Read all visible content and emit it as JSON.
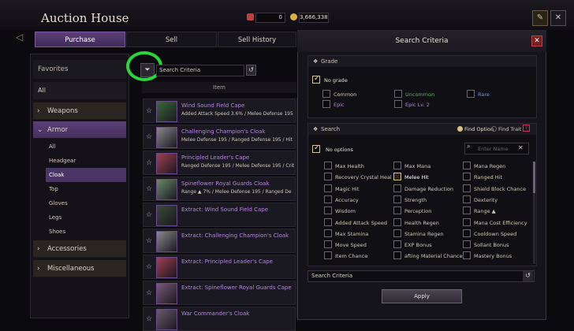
{
  "header": {
    "title": "Auction House",
    "currency1": "0",
    "currency2": "3,666,338"
  },
  "tabs": [
    {
      "label": "Purchase"
    },
    {
      "label": "Sell"
    },
    {
      "label": "Sell History"
    }
  ],
  "sidebar": {
    "favorites": "Favorites",
    "all": "All",
    "weapons": "Weapons",
    "armor": "Armor",
    "armor_subs": [
      "All",
      "Headgear",
      "Cloak",
      "Top",
      "Gloves",
      "Legs",
      "Shoes"
    ],
    "accessories": "Accessories",
    "misc": "Miscellaneous"
  },
  "list": {
    "search_placeholder": "Search Criteria",
    "column_item": "Item",
    "items": [
      {
        "name": "Wind Sound Field Cape",
        "stat": "Added Attack Speed 3.6% / Melee Defense 195"
      },
      {
        "name": "Challenging Champion's Cloak",
        "stat": "Melee Defense 195 / Ranged Defense 195 / Hit"
      },
      {
        "name": "Principled Leader's Cape",
        "stat": "Ranged Defense 195 / Melee Defense 195 / Crit"
      },
      {
        "name": "Spineflower Royal Guards Cloak",
        "stat": "Range ▲ 7% / Melee Defense 195 / Ranged De"
      },
      {
        "name": "Extract: Wind Sound Field Cape",
        "stat": ""
      },
      {
        "name": "Extract: Challenging Champion's Cloak",
        "stat": ""
      },
      {
        "name": "Extract: Principled Leader's Cape",
        "stat": ""
      },
      {
        "name": "Extract: Spineflower Royal Guards Cape",
        "stat": ""
      },
      {
        "name": "War Commander's Cloak",
        "stat": ""
      }
    ]
  },
  "modal": {
    "title": "Search Criteria",
    "grade_header": "Grade",
    "no_grade": "No grade",
    "grades": [
      "Common",
      "Uncommon",
      "Rare",
      "Epic",
      "Epic Lv. 2"
    ],
    "search_header": "Search",
    "find_option": "Find Option",
    "find_trait": "Find Trait",
    "no_options": "No options",
    "name_placeholder": "Enter Name",
    "options_col1": [
      "Max Health",
      "Recovery Crystal Heal",
      "Magic Hit",
      "Accuracy",
      "Wisdom",
      "Added Attack Speed",
      "Max Stamina",
      "Move Speed",
      "Item Chance"
    ],
    "options_col2": [
      "Max Mana",
      "Melee Hit",
      "Damage Reduction",
      "Strength",
      "Perception",
      "Health Regen",
      "Stamina Regen",
      "EXP Bonus",
      "afting Material Chance"
    ],
    "options_col3": [
      "Mana Regen",
      "Ranged Hit",
      "Shield Block Chance",
      "Dexterity",
      "Range ▲",
      "Mana Cost Efficiency",
      "Cooldown Speed",
      "Sollant Bonus",
      "Mastery Bonus"
    ],
    "bottom_search": "Search Criteria",
    "apply": "Apply"
  }
}
